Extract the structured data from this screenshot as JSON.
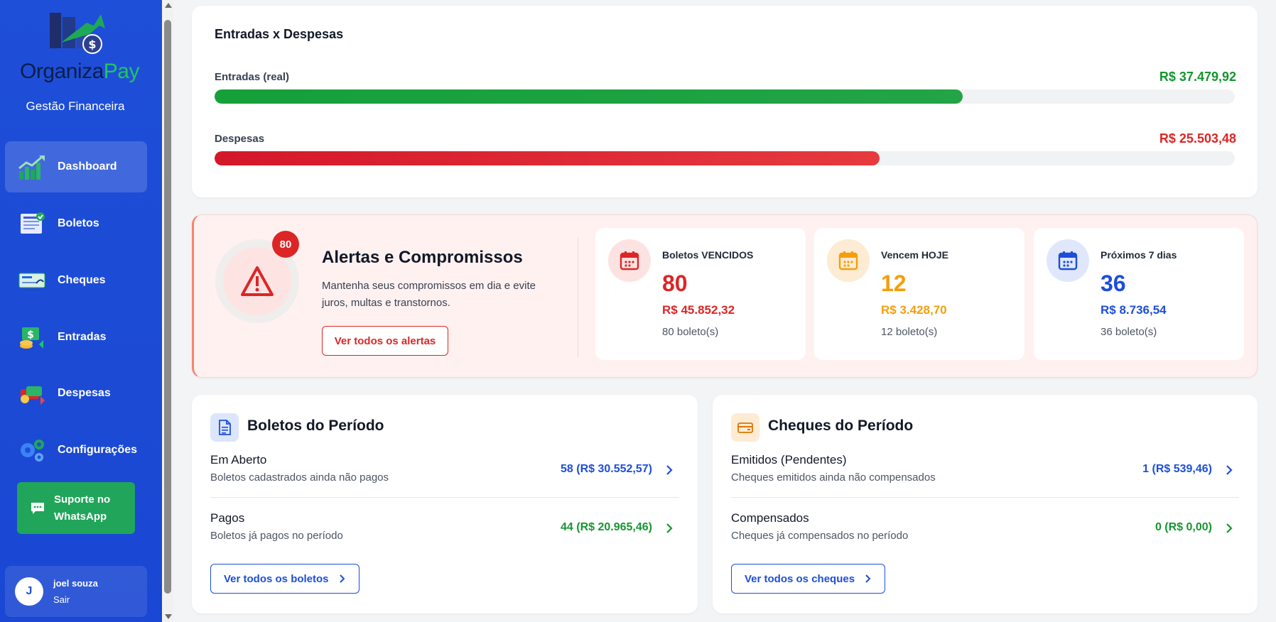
{
  "sidebar": {
    "logo": {
      "part1": "Organiza",
      "part2": "Pay"
    },
    "tagline": "Gestão Financeira",
    "items": [
      {
        "label": "Dashboard",
        "icon": "dashboard-chart-icon",
        "active": true
      },
      {
        "label": "Boletos",
        "icon": "boleto-invoice-icon"
      },
      {
        "label": "Cheques",
        "icon": "cheque-icon"
      },
      {
        "label": "Entradas",
        "icon": "money-in-icon"
      },
      {
        "label": "Despesas",
        "icon": "money-out-icon"
      },
      {
        "label": "Configurações",
        "icon": "gears-icon"
      }
    ],
    "whatsapp_label": "Suporte no WhatsApp",
    "user": {
      "initial": "J",
      "name": "joel souza",
      "logout": "Sair"
    }
  },
  "chart": {
    "title": "Entradas x Despesas",
    "entradas": {
      "label": "Entradas (real)",
      "value": "R$ 37.479,92",
      "fill_pct": 73.3
    },
    "despesas": {
      "label": "Despesas",
      "value": "R$ 25.503,48",
      "fill_pct": 65.2
    }
  },
  "alerts": {
    "badge": "80",
    "title": "Alertas e Compromissos",
    "description": "Mantenha seus compromissos em dia e evite juros, multas e transtornos.",
    "button": "Ver todos os alertas",
    "stats": [
      {
        "label": "Boletos VENCIDOS",
        "count": "80",
        "amount": "R$ 45.852,32",
        "sub": "80 boleto(s)",
        "color": "#dc2626"
      },
      {
        "label": "Vencem HOJE",
        "count": "12",
        "amount": "R$ 3.428,70",
        "sub": "12 boleto(s)",
        "color": "#f59e0b"
      },
      {
        "label": "Próximos 7 dias",
        "count": "36",
        "amount": "R$ 8.736,54",
        "sub": "36 boleto(s)",
        "color": "#1d4ed8"
      }
    ]
  },
  "boletos": {
    "title": "Boletos do Período",
    "rows": [
      {
        "title": "Em Aberto",
        "sub": "Boletos cadastrados ainda não pagos",
        "value": "58 (R$ 30.552,57)"
      },
      {
        "title": "Pagos",
        "sub": "Boletos já pagos no período",
        "value": "44 (R$ 20.965,46)"
      }
    ],
    "button": "Ver todos os boletos"
  },
  "cheques": {
    "title": "Cheques do Período",
    "rows": [
      {
        "title": "Emitidos (Pendentes)",
        "sub": "Cheques emitidos ainda não compensados",
        "value": "1 (R$ 539,46)"
      },
      {
        "title": "Compensados",
        "sub": "Cheques já compensados no período",
        "value": "0 (R$ 0,00)"
      }
    ],
    "button": "Ver todos os cheques"
  },
  "colors": {
    "sidebar": "#1e4fd8",
    "green": "#15962f",
    "red": "#dc2626",
    "orange": "#f59e0b",
    "blue": "#1d4ed8"
  }
}
